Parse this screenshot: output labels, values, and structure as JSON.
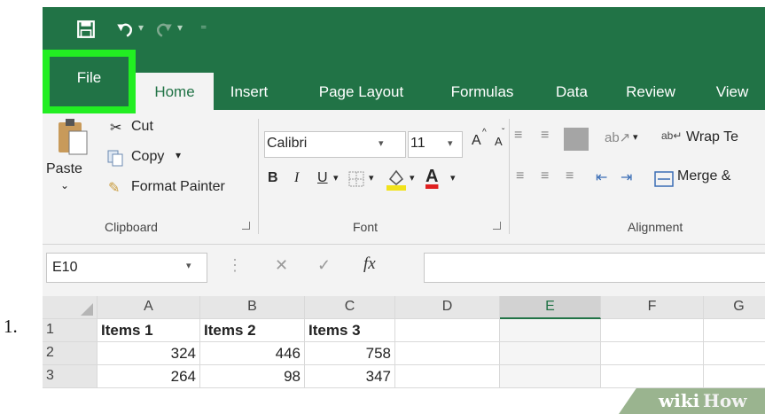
{
  "step_number": "1.",
  "quick_access": {
    "save_icon": "save-icon",
    "undo_icon": "undo-icon",
    "redo_icon": "redo-icon",
    "customize_icon": "customize-qat-icon"
  },
  "tabs": [
    {
      "label": "File"
    },
    {
      "label": "Home"
    },
    {
      "label": "Insert"
    },
    {
      "label": "Page Layout"
    },
    {
      "label": "Formulas"
    },
    {
      "label": "Data"
    },
    {
      "label": "Review"
    },
    {
      "label": "View"
    }
  ],
  "active_tab": "Home",
  "highlight_color": "#22ee22",
  "accent_color": "#217346",
  "clipboard": {
    "paste": "Paste",
    "cut": "Cut",
    "copy": "Copy",
    "format_painter": "Format Painter",
    "group_label": "Clipboard"
  },
  "font": {
    "family": "Calibri",
    "size": "11",
    "bold": "B",
    "italic": "I",
    "underline": "U",
    "font_color_letter": "A",
    "grow_letter": "A",
    "shrink_letter": "A",
    "group_label": "Font"
  },
  "alignment": {
    "wrap_text": "Wrap Te",
    "merge": "Merge &",
    "group_label": "Alignment"
  },
  "formula_bar": {
    "name_box": "E10",
    "cancel": "✕",
    "enter": "✓",
    "fx": "fx"
  },
  "grid": {
    "columns": [
      "A",
      "B",
      "C",
      "D",
      "E",
      "F",
      "G"
    ],
    "selected_column": "E",
    "rows": [
      {
        "num": "1",
        "cells": [
          "Items 1",
          "Items 2",
          "Items 3"
        ]
      },
      {
        "num": "2",
        "cells": [
          "324",
          "446",
          "758"
        ]
      },
      {
        "num": "3",
        "cells": [
          "264",
          "98",
          "347"
        ]
      }
    ]
  },
  "watermark": {
    "wiki": "wiki",
    "how": "How"
  }
}
